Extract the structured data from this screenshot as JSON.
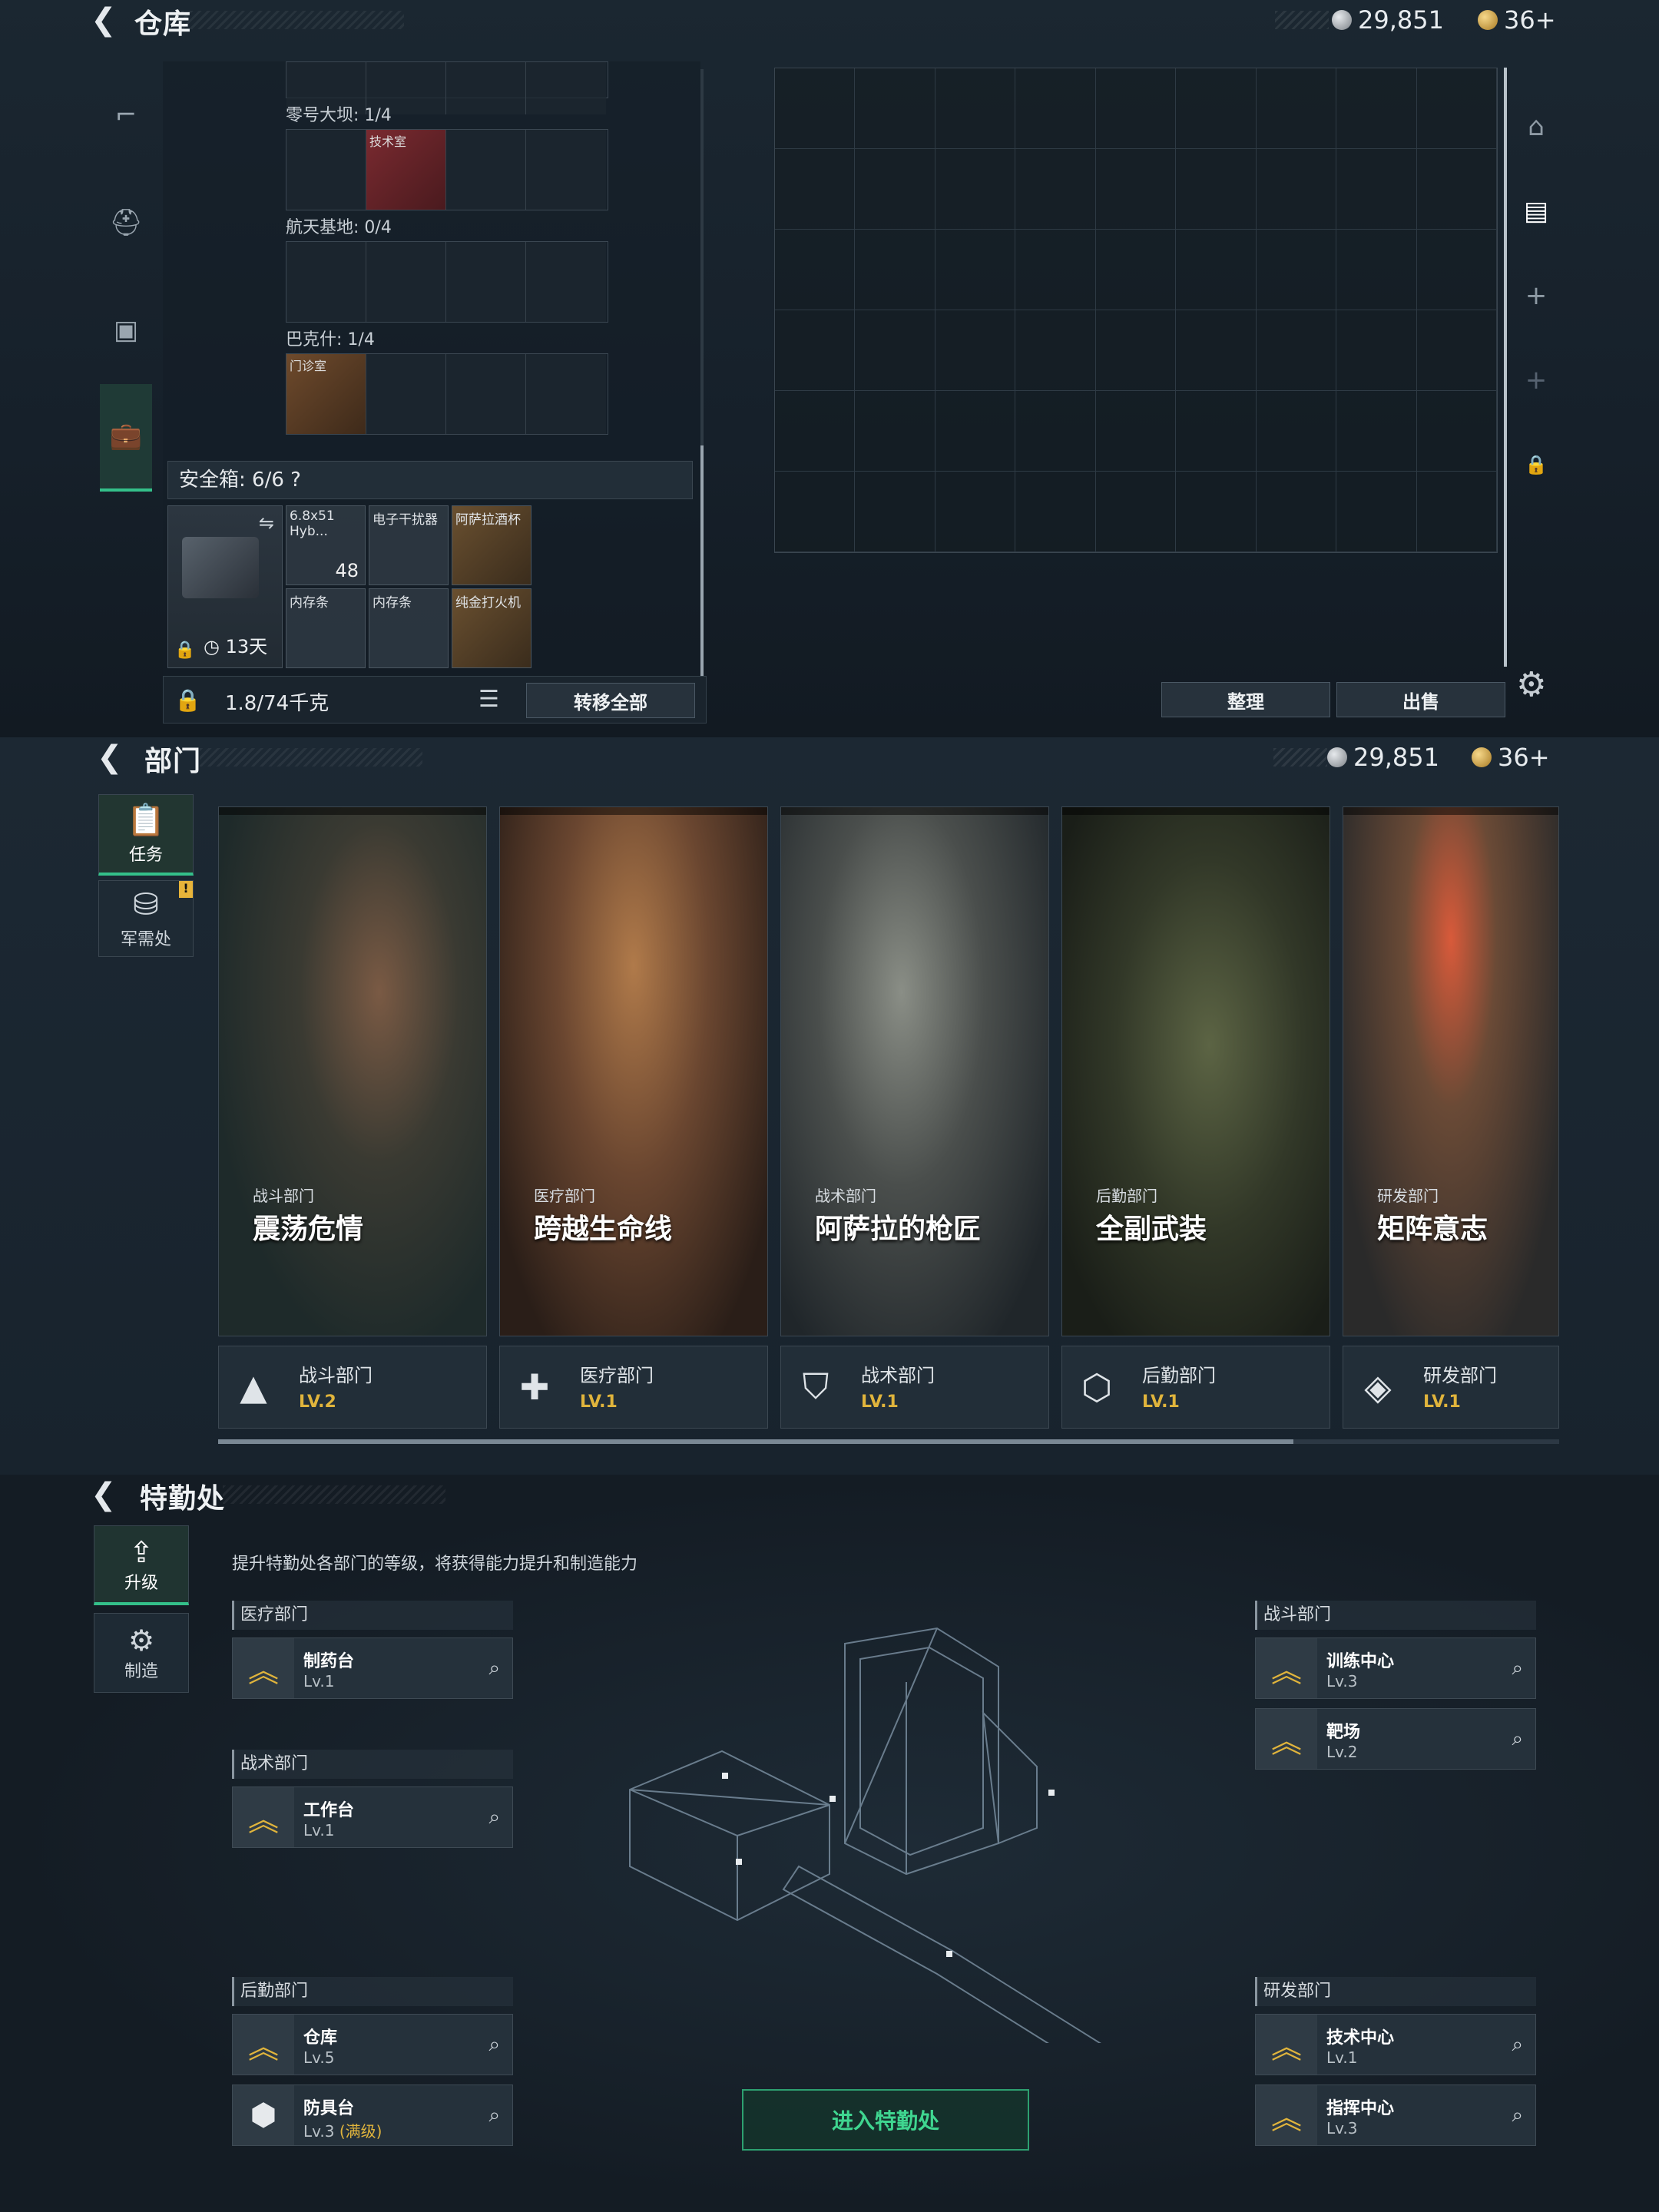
{
  "currency": {
    "silver": "29,851",
    "gold": "36+"
  },
  "warehouse": {
    "title": "仓库",
    "row_labels": [
      "零号大坝: 1/4",
      "航天基地: 0/4",
      "巴克什: 1/4"
    ],
    "items": {
      "tech": "技术室",
      "door": "门诊室"
    },
    "safe_label": "安全箱:",
    "safe_count": "6/6",
    "safe_help": "?",
    "safe_timer": "13天",
    "safe_items": [
      {
        "name": "6.8x51 Hyb...",
        "qty": "48"
      },
      {
        "name": "电子干扰器",
        "qty": ""
      },
      {
        "name": "阿萨拉酒杯",
        "qty": ""
      },
      {
        "name": "内存条",
        "qty": ""
      },
      {
        "name": "内存条",
        "qty": ""
      },
      {
        "name": "纯金打火机",
        "qty": ""
      }
    ],
    "weight": "1.8/74千克",
    "transfer_all": "转移全部",
    "sort": "整理",
    "sell": "出售"
  },
  "departments": {
    "title": "部门",
    "tabs": [
      {
        "label": "任务"
      },
      {
        "label": "军需处",
        "badge": "!"
      }
    ],
    "cards": [
      {
        "sub": "战斗部门",
        "name": "震荡危情",
        "dept": "战斗部门",
        "lv": "LV.2"
      },
      {
        "sub": "医疗部门",
        "name": "跨越生命线",
        "dept": "医疗部门",
        "lv": "LV.1"
      },
      {
        "sub": "战术部门",
        "name": "阿萨拉的枪匠",
        "dept": "战术部门",
        "lv": "LV.1"
      },
      {
        "sub": "后勤部门",
        "name": "全副武装",
        "dept": "后勤部门",
        "lv": "LV.1"
      },
      {
        "sub": "研发部门",
        "name": "矩阵意志",
        "dept": "研发部门",
        "lv": "LV.1"
      }
    ]
  },
  "special": {
    "title": "特勤处",
    "tabs": [
      {
        "label": "升级"
      },
      {
        "label": "制造"
      }
    ],
    "intro": "提升特勤处各部门的等级，将获得能力提升和制造能力",
    "sections": {
      "medical": "医疗部门",
      "tactical": "战术部门",
      "logistics": "后勤部门",
      "combat": "战斗部门",
      "rnd": "研发部门"
    },
    "facilities": {
      "pharmacy": {
        "name": "制药台",
        "lv": "Lv.1"
      },
      "workbench": {
        "name": "工作台",
        "lv": "Lv.1"
      },
      "warehouse": {
        "name": "仓库",
        "lv": "Lv.5"
      },
      "armor": {
        "name": "防具台",
        "lv": "Lv.3",
        "max": "(满级)"
      },
      "training": {
        "name": "训练中心",
        "lv": "Lv.3"
      },
      "range": {
        "name": "靶场",
        "lv": "Lv.2"
      },
      "tech": {
        "name": "技术中心",
        "lv": "Lv.1"
      },
      "command": {
        "name": "指挥中心",
        "lv": "Lv.3"
      }
    },
    "enter": "进入特勤处"
  }
}
